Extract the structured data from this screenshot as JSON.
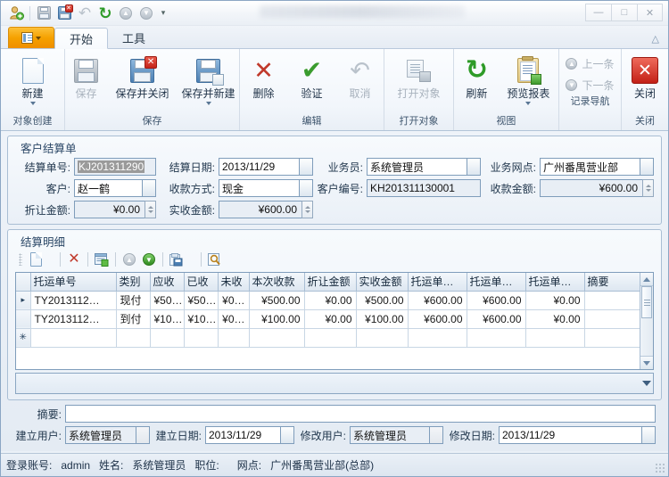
{
  "window": {
    "title_blurred": "",
    "minimize": "—",
    "maximize": "□",
    "close": "✕"
  },
  "quick_access": [
    {
      "name": "new-record-icon",
      "glyph": "person-plus"
    },
    {
      "name": "save-icon",
      "glyph": "floppy-gray"
    },
    {
      "name": "save-close-icon",
      "glyph": "floppy-x"
    },
    {
      "name": "undo-icon",
      "glyph": "undo"
    },
    {
      "name": "refresh-icon",
      "glyph": "refresh"
    },
    {
      "name": "prev-record-icon",
      "glyph": "circle-up"
    },
    {
      "name": "next-record-icon",
      "glyph": "circle-down"
    },
    {
      "name": "customize-qat-icon",
      "glyph": "chevron-down"
    }
  ],
  "tabs": [
    {
      "label": "开始",
      "active": true
    },
    {
      "label": "工具",
      "active": false
    }
  ],
  "ribbon": {
    "groups": [
      {
        "title": "对象创建",
        "buttons": [
          {
            "label": "新建",
            "icon": "new-document-icon",
            "enabled": true,
            "dropdown": true
          }
        ]
      },
      {
        "title": "保存",
        "buttons": [
          {
            "label": "保存",
            "icon": "save-icon",
            "enabled": false,
            "dropdown": false
          },
          {
            "label": "保存并关闭",
            "icon": "save-and-close-icon",
            "enabled": true,
            "dropdown": false
          },
          {
            "label": "保存并新建",
            "icon": "save-and-new-icon",
            "enabled": true,
            "dropdown": true
          }
        ]
      },
      {
        "title": "编辑",
        "buttons": [
          {
            "label": "删除",
            "icon": "delete-icon",
            "enabled": true,
            "dropdown": false
          },
          {
            "label": "验证",
            "icon": "validate-icon",
            "enabled": true,
            "dropdown": false
          },
          {
            "label": "取消",
            "icon": "cancel-icon",
            "enabled": false,
            "dropdown": false
          }
        ]
      },
      {
        "title": "打开对象",
        "buttons": [
          {
            "label": "打开对象",
            "icon": "open-object-icon",
            "enabled": false,
            "dropdown": false
          }
        ]
      },
      {
        "title": "视图",
        "buttons": [
          {
            "label": "刷新",
            "icon": "refresh-icon",
            "enabled": true,
            "dropdown": false
          },
          {
            "label": "预览报表",
            "icon": "preview-report-icon",
            "enabled": true,
            "dropdown": true
          }
        ]
      },
      {
        "title": "记录导航",
        "small_buttons": [
          {
            "label": "上一条",
            "icon": "arrow-up-circle-icon",
            "enabled": false
          },
          {
            "label": "下一条",
            "icon": "arrow-down-circle-icon",
            "enabled": false
          }
        ]
      },
      {
        "title": "关闭",
        "buttons": [
          {
            "label": "关闭",
            "icon": "close-window-icon",
            "enabled": true,
            "dropdown": false
          }
        ]
      }
    ]
  },
  "customer_settlement_panel": {
    "title": "客户结算单",
    "fields": {
      "settlement_no_label": "结算单号:",
      "settlement_no_value": "KJ201311290",
      "settlement_date_label": "结算日期:",
      "settlement_date_value": "2013/11/29",
      "salesperson_label": "业务员:",
      "salesperson_value": "系统管理员",
      "branch_label": "业务网点:",
      "branch_value": "广州番禺营业部",
      "customer_label": "客户:",
      "customer_value": "赵一鹤",
      "payment_method_label": "收款方式:",
      "payment_method_value": "现金",
      "customer_no_label": "客户编号:",
      "customer_no_value": "KH201311130001",
      "received_amount_label": "收款金额:",
      "received_amount_value": "¥600.00",
      "discount_label": "折让金额:",
      "discount_value": "¥0.00",
      "actual_label": "实收金额:",
      "actual_value": "¥600.00"
    }
  },
  "settlement_detail_panel": {
    "title": "结算明细",
    "toolbar": [
      {
        "name": "new-row-icon",
        "label": "新建"
      },
      {
        "name": "new-row-dropdown-icon",
        "label": ""
      },
      {
        "name": "delete-row-icon",
        "label": "删除"
      },
      {
        "name": "edit-row-icon",
        "label": "编辑"
      },
      {
        "name": "move-up-icon",
        "label": "上移"
      },
      {
        "name": "move-down-icon",
        "label": "下移"
      },
      {
        "name": "export-icon",
        "label": "导出"
      },
      {
        "name": "export-dropdown-icon",
        "label": ""
      },
      {
        "name": "find-icon",
        "label": "查找"
      },
      {
        "name": "toolbar-overflow-icon",
        "label": ""
      }
    ],
    "columns": [
      {
        "key": "waybill_no",
        "label": "托运单号",
        "align": "left",
        "width": 96
      },
      {
        "key": "category",
        "label": "类别",
        "align": "left",
        "width": 38
      },
      {
        "key": "receivable",
        "label": "应收",
        "align": "right",
        "width": 38
      },
      {
        "key": "received",
        "label": "已收",
        "align": "right",
        "width": 38
      },
      {
        "key": "unreceived",
        "label": "未收",
        "align": "right",
        "width": 35
      },
      {
        "key": "this_pay",
        "label": "本次收款",
        "align": "right",
        "width": 62
      },
      {
        "key": "discount",
        "label": "折让金额",
        "align": "right",
        "width": 58
      },
      {
        "key": "actual",
        "label": "实收金额",
        "align": "right",
        "width": 58
      },
      {
        "key": "wb_col1",
        "label": "托运单…",
        "align": "right",
        "width": 66
      },
      {
        "key": "wb_col2",
        "label": "托运单…",
        "align": "right",
        "width": 66
      },
      {
        "key": "wb_col3",
        "label": "托运单…",
        "align": "right",
        "width": 66
      },
      {
        "key": "remark",
        "label": "摘要",
        "align": "left",
        "width": 42
      }
    ],
    "rows": [
      {
        "selected": true,
        "marker": "▸",
        "waybill_no": "TY2013112…",
        "category": "现付",
        "receivable": "¥50…",
        "received": "¥50…",
        "unreceived": "¥0…",
        "this_pay": "¥500.00",
        "discount": "¥0.00",
        "actual": "¥500.00",
        "wb_col1": "¥600.00",
        "wb_col2": "¥600.00",
        "wb_col3": "¥0.00",
        "remark": ""
      },
      {
        "selected": false,
        "marker": "",
        "waybill_no": "TY2013112…",
        "category": "到付",
        "receivable": "¥10…",
        "received": "¥10…",
        "unreceived": "¥0…",
        "this_pay": "¥100.00",
        "discount": "¥0.00",
        "actual": "¥100.00",
        "wb_col1": "¥600.00",
        "wb_col2": "¥600.00",
        "wb_col3": "¥0.00",
        "remark": ""
      }
    ],
    "new_row_marker": "✳"
  },
  "footer": {
    "remark_label": "摘要:",
    "remark_value": "",
    "created_by_label": "建立用户:",
    "created_by_value": "系统管理员",
    "created_date_label": "建立日期:",
    "created_date_value": "2013/11/29",
    "modified_by_label": "修改用户:",
    "modified_by_value": "系统管理员",
    "modified_date_label": "修改日期:",
    "modified_date_value": "2013/11/29"
  },
  "statusbar": {
    "account_label": "登录账号:",
    "account_value": "admin",
    "name_label": "姓名:",
    "name_value": "系统管理员",
    "position_label": "职位:",
    "position_value": "",
    "branch_label": "网点:",
    "branch_value": "广州番禺营业部(总部)"
  },
  "colors": {
    "accent_orange": "#f5a100",
    "panel_border": "#a9bed4",
    "field_border": "#7f9dbb",
    "delete_red": "#c0392b",
    "validate_green": "#3a9c2e",
    "close_red": "#c32016"
  }
}
